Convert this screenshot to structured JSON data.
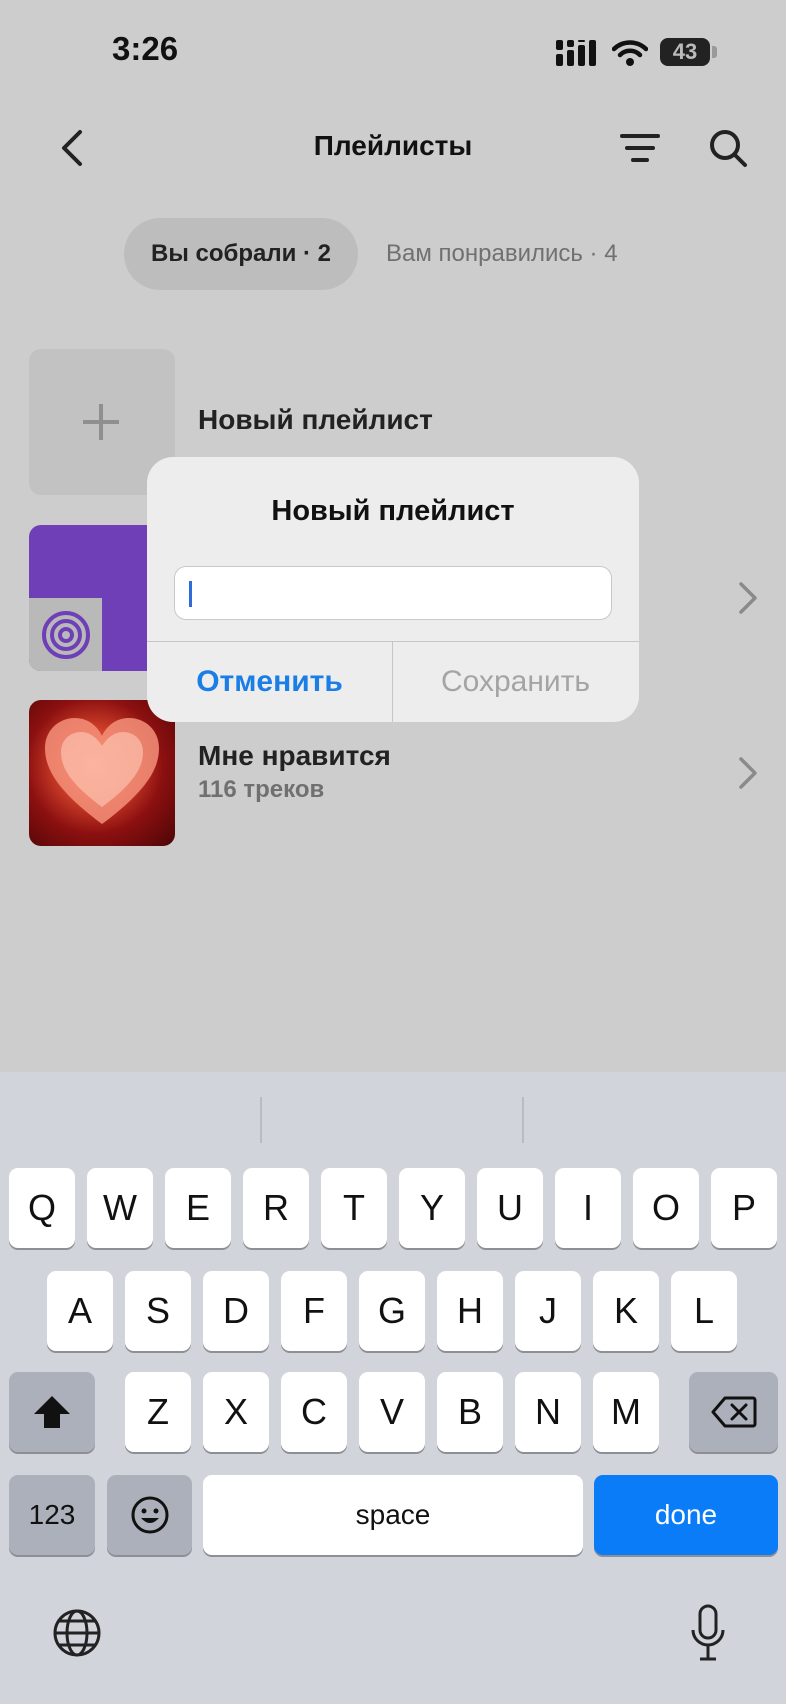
{
  "status_bar": {
    "time": "3:26",
    "battery": "43"
  },
  "header": {
    "title": "Плейлисты"
  },
  "filters": {
    "mine": "Вы собрали · 2",
    "liked": "Вам понравились · 4"
  },
  "list": {
    "new_playlist": "Новый плейлист",
    "liked": {
      "title": "Мне нравится",
      "subtitle": "116 треков"
    }
  },
  "dialog": {
    "title": "Новый плейлист",
    "input_value": "",
    "cancel": "Отменить",
    "save": "Сохранить"
  },
  "keyboard": {
    "row1": [
      "Q",
      "W",
      "E",
      "R",
      "T",
      "Y",
      "U",
      "I",
      "O",
      "P"
    ],
    "row2": [
      "A",
      "S",
      "D",
      "F",
      "G",
      "H",
      "J",
      "K",
      "L"
    ],
    "row3": [
      "Z",
      "X",
      "C",
      "V",
      "B",
      "N",
      "M"
    ],
    "numbers": "123",
    "space": "space",
    "done": "done"
  },
  "colors": {
    "accent": "#1a7ee6",
    "done_key": "#0a7cf8",
    "purple": "#6f3fb8"
  },
  "icons": [
    "signal-icon",
    "wifi-icon",
    "back-icon",
    "sort-icon",
    "search-icon",
    "plus-icon",
    "chevron-right-icon",
    "shift-icon",
    "backspace-icon",
    "emoji-icon",
    "globe-icon",
    "mic-icon"
  ]
}
